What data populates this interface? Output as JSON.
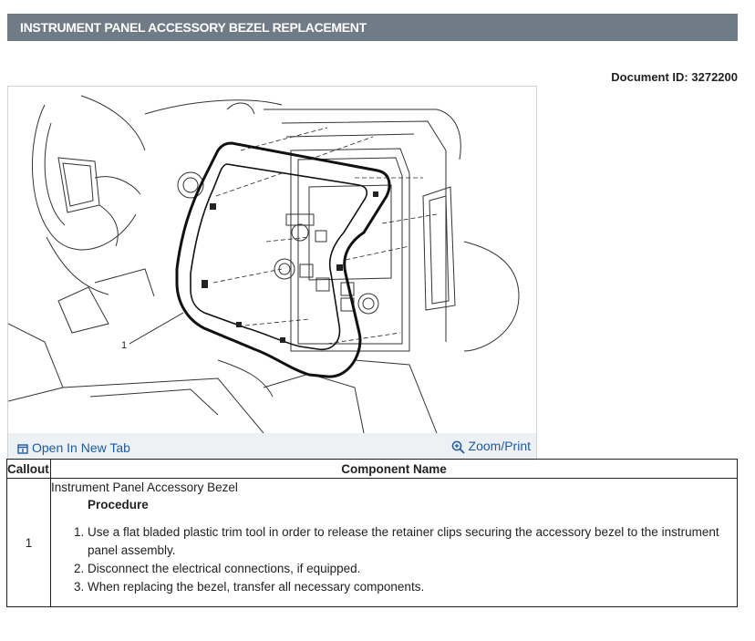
{
  "header": {
    "title": "INSTRUMENT PANEL ACCESSORY BEZEL REPLACEMENT"
  },
  "document": {
    "id_label": "Document ID: 3272200"
  },
  "figure": {
    "callout_number": "1",
    "open_new_tab_label": "Open In New Tab",
    "zoom_print_label": "Zoom/Print"
  },
  "table": {
    "headers": {
      "callout": "Callout",
      "component": "Component Name"
    },
    "rows": [
      {
        "callout": "1",
        "component": "Instrument Panel Accessory Bezel",
        "procedure_title": "Procedure",
        "steps": [
          "Use a flat bladed plastic trim tool in order to release the retainer clips securing the accessory bezel to the instrument panel assembly.",
          "Disconnect the electrical connections, if equipped.",
          "When replacing the bezel, transfer all necessary components."
        ]
      }
    ]
  }
}
